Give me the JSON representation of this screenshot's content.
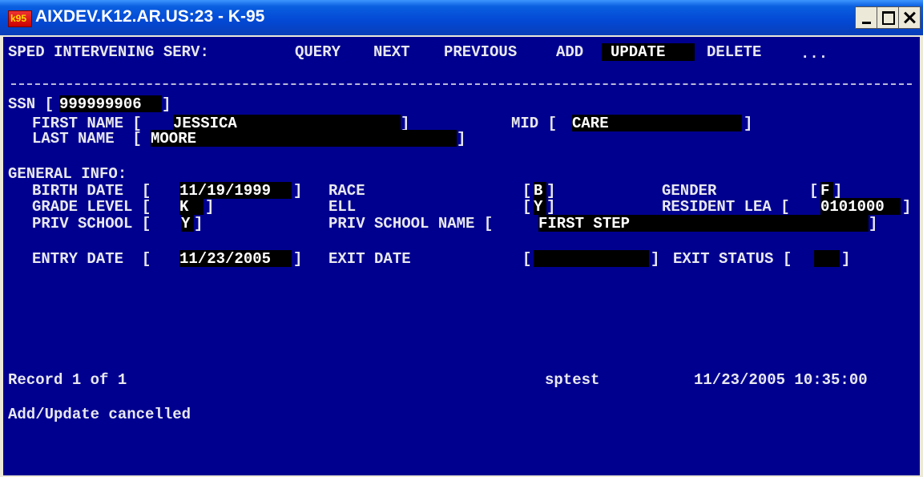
{
  "window": {
    "title": "AIXDEV.K12.AR.US:23 - K-95",
    "icon_text": "k95"
  },
  "menu": {
    "screen_name": "SPED INTERVENING SERV:",
    "items": [
      "QUERY",
      "NEXT",
      "PREVIOUS",
      "ADD",
      "UPDATE",
      "DELETE",
      "..."
    ],
    "selected": "UPDATE"
  },
  "student": {
    "ssn_label": "SSN [",
    "ssn": "999999906",
    "ssn_close": "]",
    "first_name_label": "FIRST NAME [",
    "first_name": "JESSICA",
    "first_close": "]",
    "mid_label": "MID [",
    "mid": "CARE",
    "mid_close": "]",
    "last_name_label": "LAST NAME  [",
    "last_name": "MOORE",
    "last_close": "]"
  },
  "general": {
    "heading": "GENERAL INFO:",
    "birth_date_label": "BIRTH DATE  [",
    "birth_date": "11/19/1999",
    "birth_close": "]",
    "race_label": "RACE",
    "race_open": "[",
    "race": "B",
    "race_close": "]",
    "gender_label": "GENDER",
    "gender_open": "[",
    "gender": "F",
    "gender_close": "]",
    "grade_label": "GRADE LEVEL [",
    "grade": "K ",
    "grade_close": "]",
    "ell_label": "ELL",
    "ell_open": "[",
    "ell": "Y",
    "ell_close": "]",
    "resident_lea_label": "RESIDENT LEA [",
    "resident_lea": "0101000",
    "lea_close": "]",
    "priv_school_label": "PRIV SCHOOL [",
    "priv_school": "Y",
    "priv_close": "]",
    "priv_school_name_label": "PRIV SCHOOL NAME [",
    "priv_school_name": "FIRST STEP",
    "psn_close": "]",
    "entry_date_label": "ENTRY DATE  [",
    "entry_date": "11/23/2005",
    "entry_close": "]",
    "exit_date_label": "EXIT DATE",
    "exit_open": "[",
    "exit_date": "",
    "exit_close": "]",
    "exit_status_label": "EXIT STATUS [",
    "exit_status": "",
    "status_close": "]"
  },
  "status": {
    "record": "Record 1 of 1",
    "user": "sptest",
    "datetime": "11/23/2005 10:35:00",
    "message": "Add/Update cancelled"
  }
}
